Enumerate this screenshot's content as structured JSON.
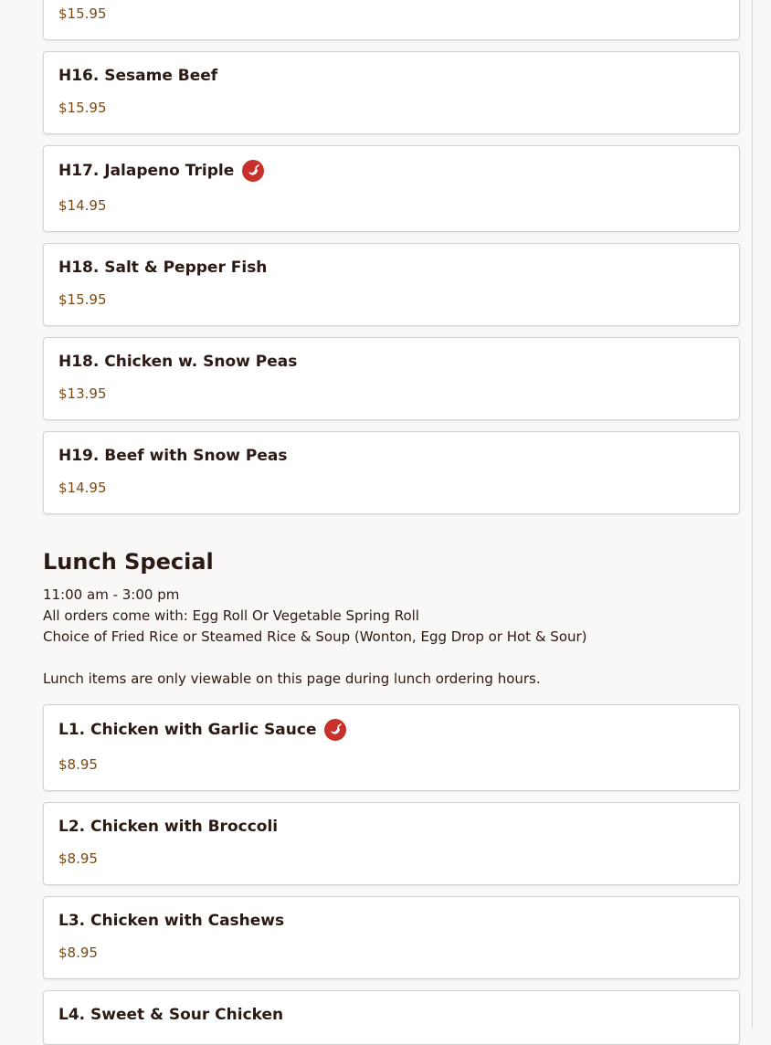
{
  "colors": {
    "background": "#faf8f6",
    "card_border": "#d6d1cc",
    "price": "#7a4a12",
    "spicy_badge": "#c8302c"
  },
  "items_top": [
    {
      "name": "",
      "price": "$15.95"
    },
    {
      "name": "H16. Sesame Beef",
      "price": "$15.95",
      "spicy": false
    },
    {
      "name": "H17. Jalapeno Triple",
      "price": "$14.95",
      "spicy": true
    },
    {
      "name": "H18. Salt & Pepper Fish",
      "price": "$15.95",
      "spicy": false
    },
    {
      "name": "H18. Chicken w. Snow Peas",
      "price": "$13.95",
      "spicy": false
    },
    {
      "name": "H19. Beef with Snow Peas",
      "price": "$14.95",
      "spicy": false
    }
  ],
  "lunch": {
    "title": "Lunch Special",
    "hours": "11:00 am - 3:00 pm",
    "includes": "All orders come with: Egg Roll Or Vegetable Spring Roll",
    "choice": "Choice of Fried Rice or Steamed Rice & Soup (Wonton, Egg Drop or Hot & Sour)",
    "notice": "Lunch items are only viewable on this page during lunch ordering hours.",
    "items": [
      {
        "name": "L1. Chicken with Garlic Sauce",
        "price": "$8.95",
        "spicy": true
      },
      {
        "name": "L2. Chicken with Broccoli",
        "price": "$8.95",
        "spicy": false
      },
      {
        "name": "L3. Chicken with Cashews",
        "price": "$8.95",
        "spicy": false
      },
      {
        "name": "L4. Sweet & Sour Chicken",
        "price": "",
        "spicy": false
      }
    ]
  },
  "icons": {
    "spicy": "chili-pepper-icon"
  }
}
